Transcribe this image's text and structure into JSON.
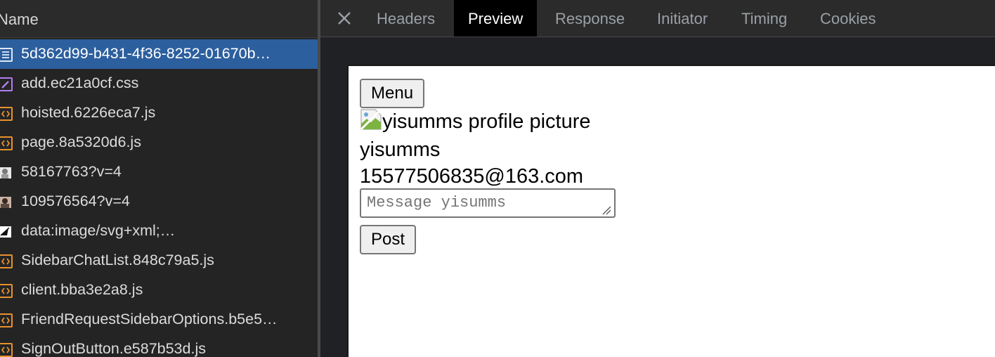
{
  "network": {
    "column_header": "Name",
    "requests": [
      {
        "name": "5d362d99-b431-4f36-8252-01670b…",
        "icon": "document-icon",
        "selected": true
      },
      {
        "name": "add.ec21a0cf.css",
        "icon": "stylesheet-icon",
        "selected": false
      },
      {
        "name": "hoisted.6226eca7.js",
        "icon": "script-icon",
        "selected": false
      },
      {
        "name": "page.8a5320d6.js",
        "icon": "script-icon",
        "selected": false
      },
      {
        "name": "58167763?v=4",
        "icon": "image-thumbnail-icon",
        "selected": false
      },
      {
        "name": "109576564?v=4",
        "icon": "image-thumbnail-icon",
        "selected": false
      },
      {
        "name": "data:image/svg+xml;…",
        "icon": "svg-image-icon",
        "selected": false
      },
      {
        "name": "SidebarChatList.848c79a5.js",
        "icon": "script-icon",
        "selected": false
      },
      {
        "name": "client.bba3e2a8.js",
        "icon": "script-icon",
        "selected": false
      },
      {
        "name": "FriendRequestSidebarOptions.b5e5…",
        "icon": "script-icon",
        "selected": false
      },
      {
        "name": "SignOutButton.e587b53d.js",
        "icon": "script-icon",
        "selected": false
      }
    ]
  },
  "details": {
    "tabs": [
      {
        "label": "Headers",
        "active": false
      },
      {
        "label": "Preview",
        "active": true
      },
      {
        "label": "Response",
        "active": false
      },
      {
        "label": "Initiator",
        "active": false
      },
      {
        "label": "Timing",
        "active": false
      },
      {
        "label": "Cookies",
        "active": false
      }
    ],
    "close_icon": "close-icon"
  },
  "preview": {
    "menu_label": "Menu",
    "profile_alt": "yisumms profile picture",
    "username": "yisumms",
    "email": "15577506835@163.com",
    "message_placeholder": "Message yisumms",
    "message_value": "",
    "post_label": "Post"
  },
  "colors": {
    "selected_row": "#2c5f9e",
    "script_icon": "#e8912d",
    "stylesheet_icon": "#b27cf0",
    "document_icon": "#c9d7ee",
    "active_tab_bg": "#000000"
  }
}
